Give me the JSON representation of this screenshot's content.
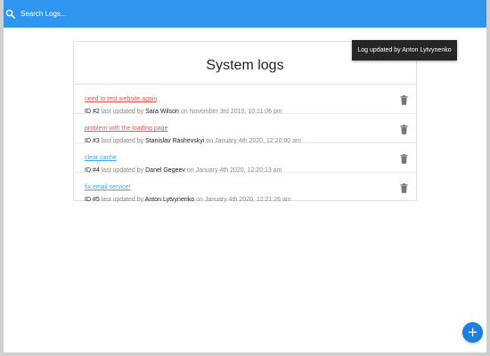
{
  "search": {
    "placeholder": "Search Logs..."
  },
  "card": {
    "title": "System logs"
  },
  "logs": [
    {
      "message": "need to test website again",
      "id_label": "ID #2",
      "updated_text": "last updated by",
      "tech": "Sara Wilson",
      "on_text": "on",
      "date": "November 3rd 2019, 10:11:06 pm",
      "attention": true
    },
    {
      "message": "problem with the loading page",
      "id_label": "ID #3",
      "updated_text": "last updated by",
      "tech": "Stanislav Rashevskyi",
      "on_text": "on",
      "date": "January 4th 2020, 12:20:00 am",
      "attention": true
    },
    {
      "message": "clear cache",
      "id_label": "ID #4",
      "updated_text": "last updated by",
      "tech": "Danel Gegeev",
      "on_text": "on",
      "date": "January 4th 2020, 12:20:13 am",
      "attention": false
    },
    {
      "message": "fix email service!",
      "id_label": "ID #5",
      "updated_text": "last updated by",
      "tech": "Anton Lytvynenko",
      "on_text": "on",
      "date": "January 4th 2020, 12:21:26 am",
      "attention": false
    }
  ],
  "toast": {
    "text": "Log updated by Anton Lytvynenko"
  },
  "fab": {
    "icon": "+"
  },
  "colors": {
    "topbar": "#2f96ef",
    "attention": "#ef5350",
    "normal": "#42a5f5",
    "fab": "#1e7fdc"
  }
}
